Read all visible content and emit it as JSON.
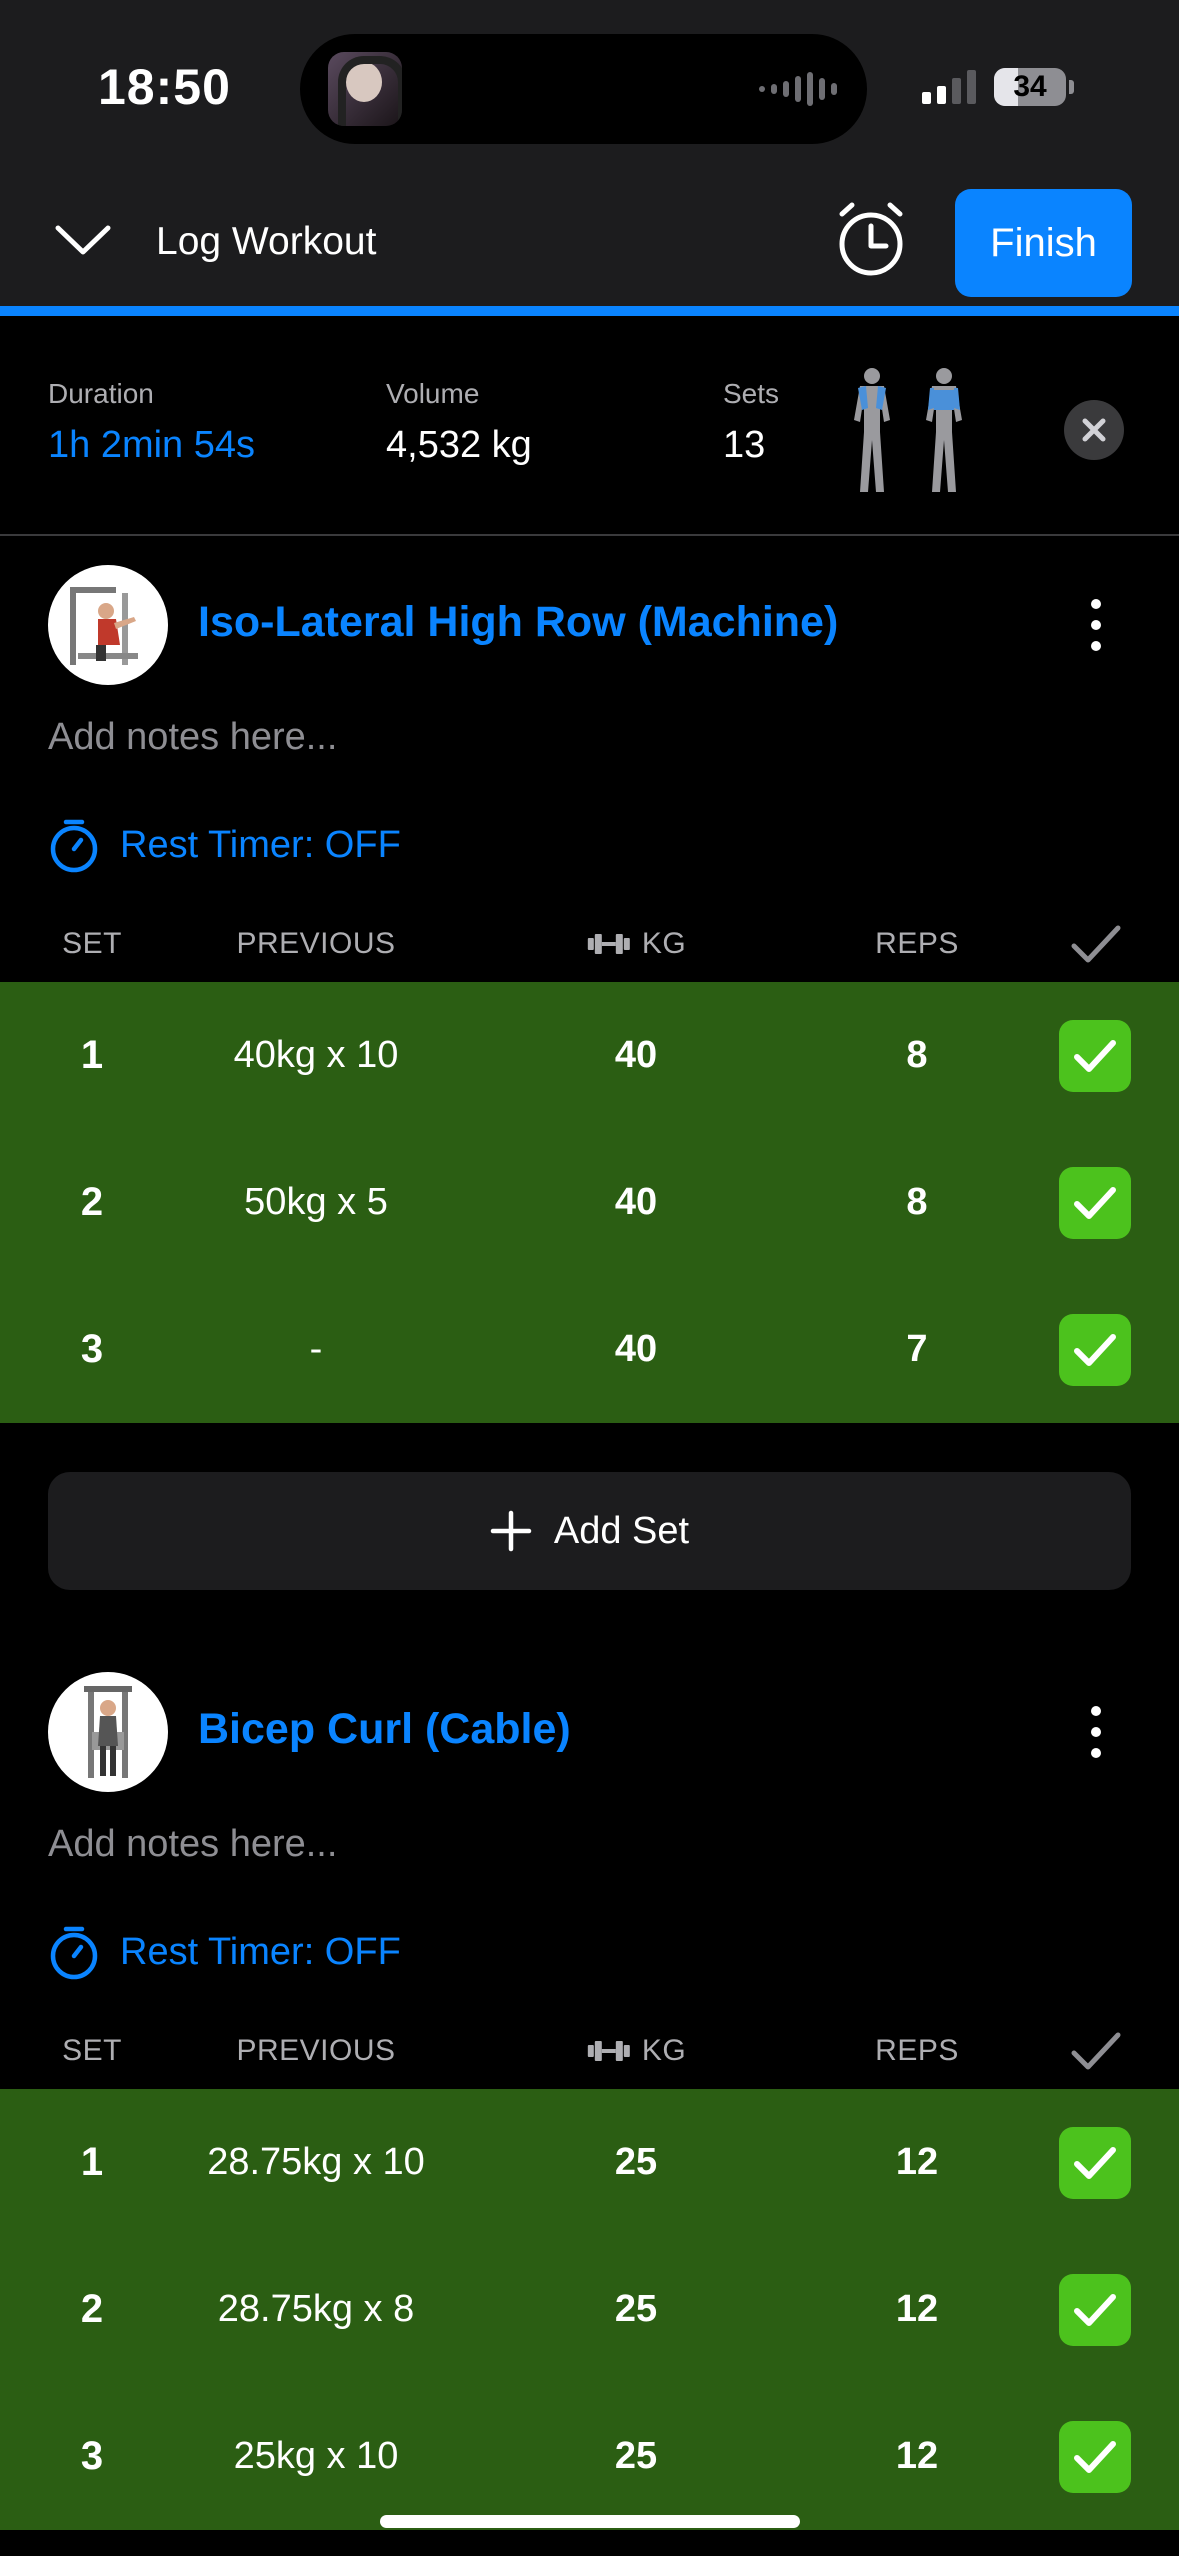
{
  "status_bar": {
    "time": "18:50",
    "battery": "34",
    "battery_level": 0.34
  },
  "header": {
    "title": "Log Workout",
    "finish_label": "Finish",
    "accent": "#0a84ff"
  },
  "summary": {
    "duration_label": "Duration",
    "duration_value": "1h 2min 54s",
    "volume_label": "Volume",
    "volume_value": "4,532 kg",
    "sets_label": "Sets",
    "sets_value": "13"
  },
  "exercises": [
    {
      "name": "Iso-Lateral High Row (Machine)",
      "notes_placeholder": "Add notes here...",
      "rest_timer": "Rest Timer: OFF",
      "columns": {
        "set": "SET",
        "previous": "PREVIOUS",
        "kg": "KG",
        "reps": "REPS"
      },
      "sets": [
        {
          "set": "1",
          "previous": "40kg x 10",
          "kg": "40",
          "reps": "8",
          "done": true
        },
        {
          "set": "2",
          "previous": "50kg x 5",
          "kg": "40",
          "reps": "8",
          "done": true
        },
        {
          "set": "3",
          "previous": "-",
          "kg": "40",
          "reps": "7",
          "done": true
        }
      ],
      "add_set_label": "Add Set"
    },
    {
      "name": "Bicep Curl (Cable)",
      "notes_placeholder": "Add notes here...",
      "rest_timer": "Rest Timer: OFF",
      "columns": {
        "set": "SET",
        "previous": "PREVIOUS",
        "kg": "KG",
        "reps": "REPS"
      },
      "sets": [
        {
          "set": "1",
          "previous": "28.75kg x 10",
          "kg": "25",
          "reps": "12",
          "done": true
        },
        {
          "set": "2",
          "previous": "28.75kg x 8",
          "kg": "25",
          "reps": "12",
          "done": true
        },
        {
          "set": "3",
          "previous": "25kg x 10",
          "kg": "25",
          "reps": "12",
          "done": true
        }
      ]
    }
  ],
  "colors": {
    "completed_row": "#2b5e13",
    "check": "#4cc21d"
  }
}
